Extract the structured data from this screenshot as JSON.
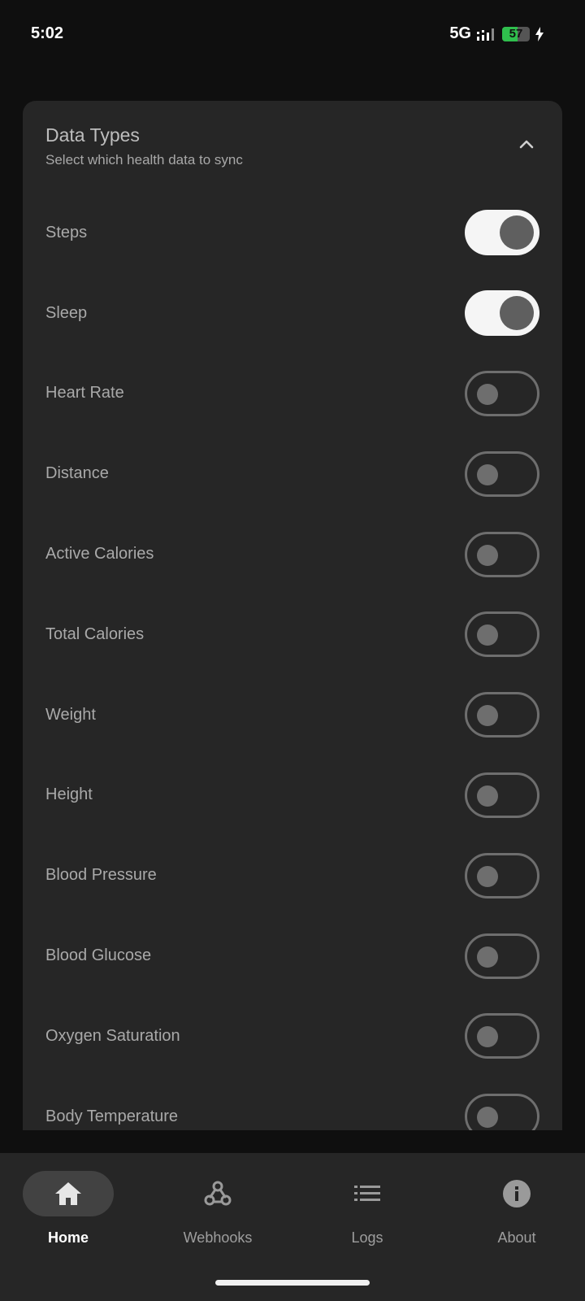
{
  "status_bar": {
    "time": "5:02",
    "network": "5G",
    "battery_level": "57",
    "battery_fraction": 0.57,
    "charging": true
  },
  "card": {
    "title": "Data Types",
    "subtitle": "Select which health data to sync",
    "collapse_icon": "chevron-up-icon"
  },
  "data_types": [
    {
      "label": "Steps",
      "enabled": true
    },
    {
      "label": "Sleep",
      "enabled": true
    },
    {
      "label": "Heart Rate",
      "enabled": false
    },
    {
      "label": "Distance",
      "enabled": false
    },
    {
      "label": "Active Calories",
      "enabled": false
    },
    {
      "label": "Total Calories",
      "enabled": false
    },
    {
      "label": "Weight",
      "enabled": false
    },
    {
      "label": "Height",
      "enabled": false
    },
    {
      "label": "Blood Pressure",
      "enabled": false
    },
    {
      "label": "Blood Glucose",
      "enabled": false
    },
    {
      "label": "Oxygen Saturation",
      "enabled": false
    },
    {
      "label": "Body Temperature",
      "enabled": false
    }
  ],
  "nav": {
    "active": "home",
    "items": [
      {
        "id": "home",
        "label": "Home",
        "icon": "home-icon"
      },
      {
        "id": "webhooks",
        "label": "Webhooks",
        "icon": "webhook-icon"
      },
      {
        "id": "logs",
        "label": "Logs",
        "icon": "list-icon"
      },
      {
        "id": "about",
        "label": "About",
        "icon": "info-icon"
      }
    ]
  },
  "colors": {
    "background": "#0f0f0f",
    "surface": "#262626",
    "switch_on_track": "#f5f5f5",
    "switch_off_outline": "#6e6e6e",
    "battery_green": "#2fbf4d"
  }
}
